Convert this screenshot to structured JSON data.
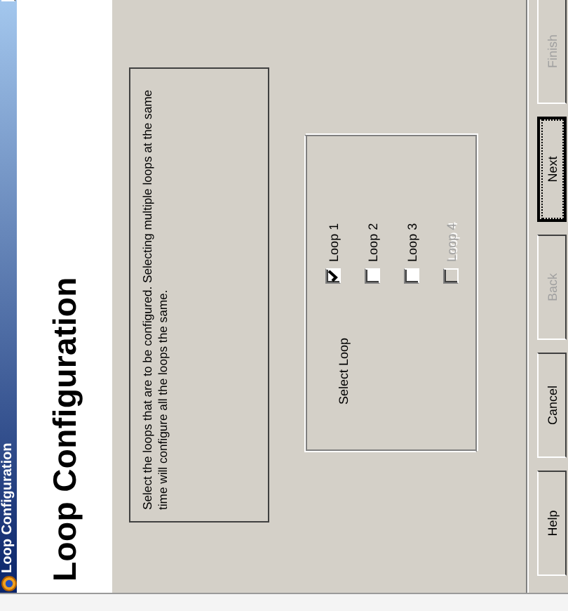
{
  "window": {
    "title": "Loop Configuration"
  },
  "header": {
    "title": "Loop Configuration"
  },
  "description": "Select the loops that are to be configured. Selecting multiple loops at the same time will configure all the loops the same.",
  "loop_group": {
    "label": "Select Loop",
    "loops": [
      {
        "label": "Loop 1",
        "checked": true,
        "disabled": false
      },
      {
        "label": "Loop 2",
        "checked": false,
        "disabled": false
      },
      {
        "label": "Loop 3",
        "checked": false,
        "disabled": false
      },
      {
        "label": "Loop 4",
        "checked": false,
        "disabled": true
      }
    ]
  },
  "buttons": [
    {
      "label": "Help",
      "disabled": false,
      "default": false
    },
    {
      "label": "Cancel",
      "disabled": false,
      "default": false
    },
    {
      "label": "Back",
      "disabled": true,
      "default": false
    },
    {
      "label": "Next",
      "disabled": false,
      "default": true
    },
    {
      "label": "Finish",
      "disabled": true,
      "default": false
    }
  ]
}
